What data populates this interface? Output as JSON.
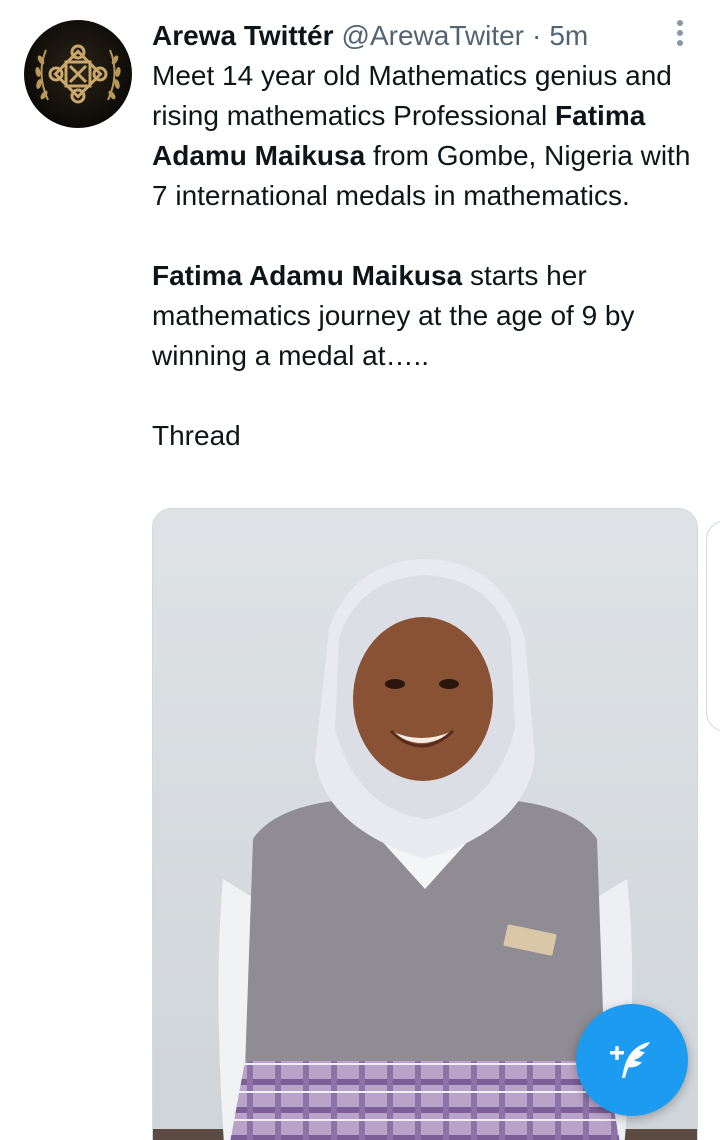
{
  "tweet": {
    "display_name": "Arewa Twittér",
    "handle": "@ArewaTwiter",
    "separator": "·",
    "time": "5m",
    "text": {
      "p1_start": "Meet 14 year old Mathematics genius and rising mathematics Professional ",
      "p1_bold": "Fatima Adamu Maikusa",
      "p1_end": " from Gombe, Nigeria with 7 international medals in mathematics.",
      "p2_bold": "Fatima Adamu Maikusa",
      "p2_end": " starts her mathematics journey at the age of 9 by winning a medal at…..",
      "p3": "Thread"
    },
    "avatar_icon": "gold-knot-laurel-logo",
    "more_icon": "more-vertical-icon"
  },
  "fab": {
    "icon": "compose-tweet-icon",
    "color": "#1d9bf0"
  },
  "colors": {
    "primary_text": "#0f1419",
    "secondary_text": "#536471",
    "accent": "#1d9bf0"
  }
}
